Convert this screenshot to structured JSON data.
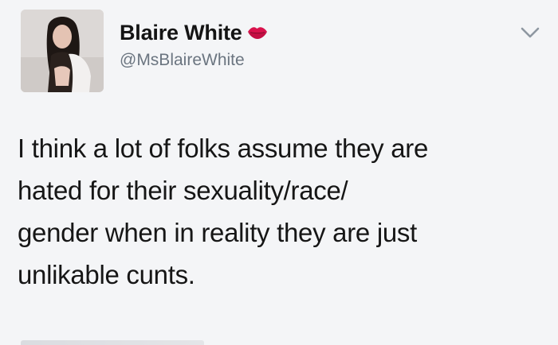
{
  "user": {
    "display_name": "Blaire White",
    "handle": "@MsBlaireWhite",
    "badge_icon": "kiss-lips-icon",
    "avatar_icon": "profile-photo"
  },
  "tweet": {
    "lines": [
      "I think a lot of folks assume they are",
      "hated for their sexuality/race/",
      "gender when in reality they are just",
      "unlikable cunts."
    ]
  },
  "menu": {
    "icon": "chevron-down-icon"
  },
  "colors": {
    "background": "#f4f5f7",
    "text": "#161616",
    "handle": "#6b7580",
    "lips": "#d9124c"
  }
}
